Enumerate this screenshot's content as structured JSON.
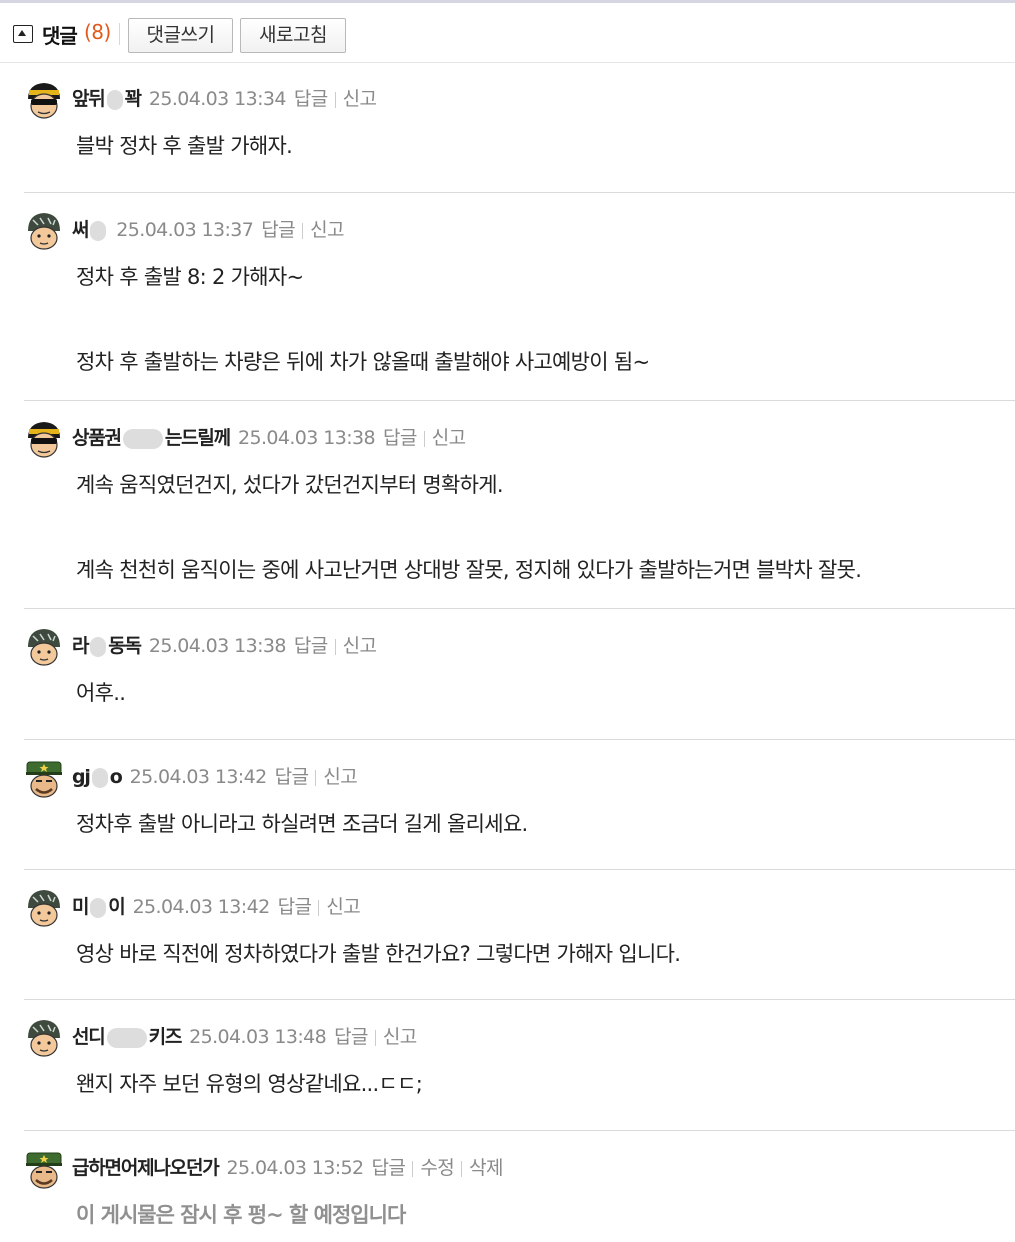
{
  "header": {
    "title": "댓글",
    "count": "(8)",
    "write_label": "댓글쓰기",
    "refresh_label": "새로고침"
  },
  "comments": [
    {
      "nick_a": "앞뒤",
      "nick_b": "꽉",
      "date": "25.04.03 13:34",
      "reply": "답글",
      "report": "신고",
      "p1": "블박 정차 후 출발 가해자.",
      "avatar": "sunglasses-helmet"
    },
    {
      "nick_a": "써",
      "nick_b": "",
      "date": "25.04.03 13:37",
      "reply": "답글",
      "report": "신고",
      "p1": "정차 후 출발 8: 2 가해자~",
      "p2": "정차 후 출발하는 차량은 뒤에 차가 않올때 출발해야 사고예방이 됨~",
      "avatar": "dark-helmet"
    },
    {
      "nick_a": "상품권",
      "nick_b": "는드릴께",
      "date": "25.04.03 13:38",
      "reply": "답글",
      "report": "신고",
      "p1": "계속 움직였던건지, 섰다가 갔던건지부터 명확하게.",
      "p2": "계속 천천히 움직이는 중에 사고난거면 상대방 잘못, 정지해 있다가 출발하는거면 블박차 잘못.",
      "avatar": "sunglasses-helmet"
    },
    {
      "nick_a": "라",
      "nick_b": "동독",
      "date": "25.04.03 13:38",
      "reply": "답글",
      "report": "신고",
      "p1": "어후..",
      "avatar": "dark-helmet"
    },
    {
      "nick_a": "gj",
      "nick_b": "o",
      "date": "25.04.03 13:42",
      "reply": "답글",
      "report": "신고",
      "p1": "정차후 출발 아니라고 하실려면 조금더 길게 올리세요.",
      "avatar": "military-cap"
    },
    {
      "nick_a": "미",
      "nick_b": "이",
      "date": "25.04.03 13:42",
      "reply": "답글",
      "report": "신고",
      "p1": "영상 바로 직전에 정차하였다가 출발 한건가요? 그렇다면 가해자 입니다.",
      "avatar": "dark-helmet"
    },
    {
      "nick_a": "선디",
      "nick_b": "키즈",
      "date": "25.04.03 13:48",
      "reply": "답글",
      "report": "신고",
      "p1": "왠지 자주 보던 유형의 영상같네요...ㄷㄷ;",
      "avatar": "dark-helmet"
    },
    {
      "nick_a": "급하면어제나오던가",
      "nick_b": "",
      "date": "25.04.03 13:52",
      "reply": "답글",
      "edit": "수정",
      "delete": "삭제",
      "p1": "이 게시물은 잠시 후 펑~ 할 예정입니다",
      "avatar": "military-cap"
    }
  ],
  "colors": {
    "count": "#e05a1e",
    "meta": "#8a8a8a",
    "notice": "#909090"
  }
}
